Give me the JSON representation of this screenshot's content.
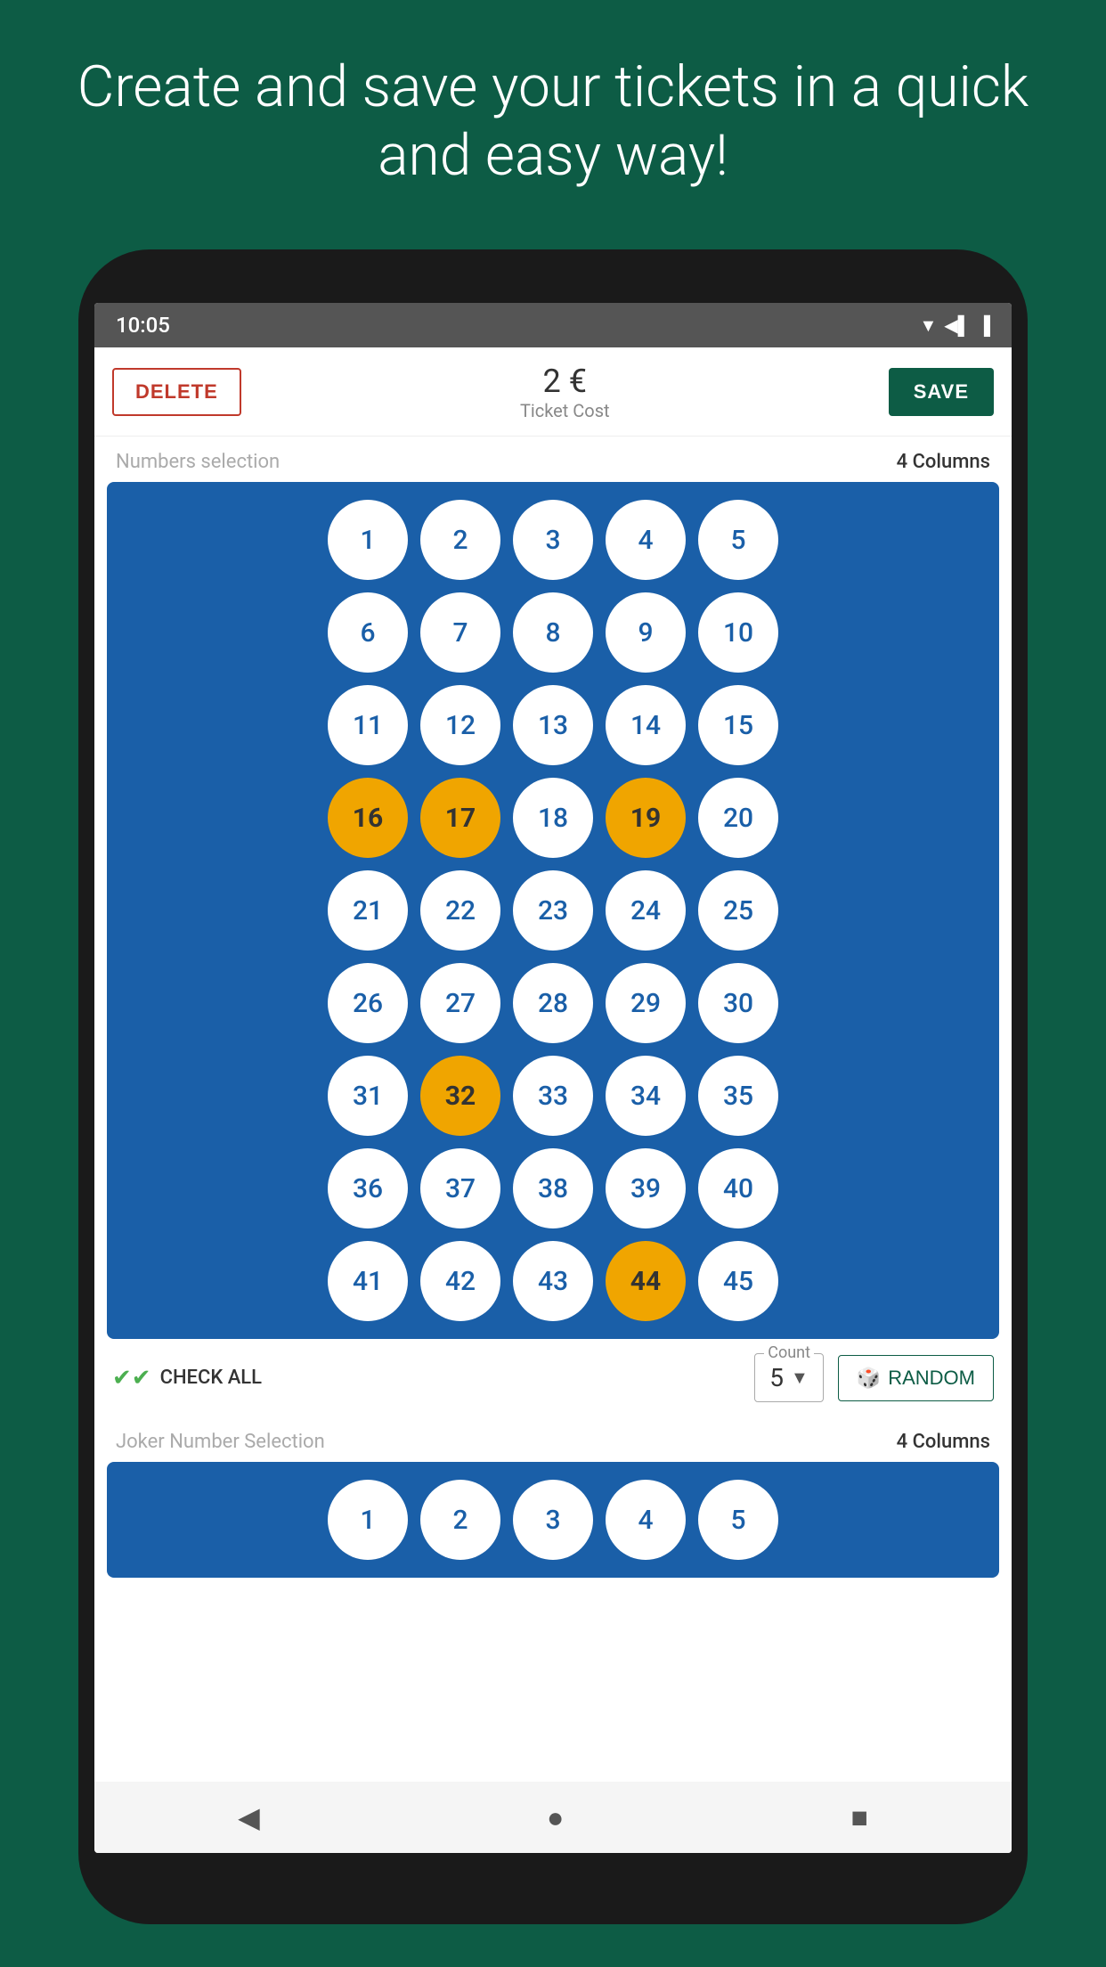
{
  "hero": {
    "text": "Create and save your tickets in a quick and easy way!"
  },
  "status_bar": {
    "time": "10:05",
    "icons": "▼◀ ▌▌▌"
  },
  "top_bar": {
    "delete_label": "DELETE",
    "ticket_amount": "2 €",
    "ticket_cost_label": "Ticket Cost",
    "save_label": "SAVE"
  },
  "numbers_section": {
    "label": "Numbers selection",
    "columns_label": "4 Columns"
  },
  "numbers": [
    {
      "value": 1,
      "selected": false
    },
    {
      "value": 2,
      "selected": false
    },
    {
      "value": 3,
      "selected": false
    },
    {
      "value": 4,
      "selected": false
    },
    {
      "value": 5,
      "selected": false
    },
    {
      "value": 6,
      "selected": false
    },
    {
      "value": 7,
      "selected": false
    },
    {
      "value": 8,
      "selected": false
    },
    {
      "value": 9,
      "selected": false
    },
    {
      "value": 10,
      "selected": false
    },
    {
      "value": 11,
      "selected": false
    },
    {
      "value": 12,
      "selected": false
    },
    {
      "value": 13,
      "selected": false
    },
    {
      "value": 14,
      "selected": false
    },
    {
      "value": 15,
      "selected": false
    },
    {
      "value": 16,
      "selected": true
    },
    {
      "value": 17,
      "selected": true
    },
    {
      "value": 18,
      "selected": false
    },
    {
      "value": 19,
      "selected": true
    },
    {
      "value": 20,
      "selected": false
    },
    {
      "value": 21,
      "selected": false
    },
    {
      "value": 22,
      "selected": false
    },
    {
      "value": 23,
      "selected": false
    },
    {
      "value": 24,
      "selected": false
    },
    {
      "value": 25,
      "selected": false
    },
    {
      "value": 26,
      "selected": false
    },
    {
      "value": 27,
      "selected": false
    },
    {
      "value": 28,
      "selected": false
    },
    {
      "value": 29,
      "selected": false
    },
    {
      "value": 30,
      "selected": false
    },
    {
      "value": 31,
      "selected": false
    },
    {
      "value": 32,
      "selected": true
    },
    {
      "value": 33,
      "selected": false
    },
    {
      "value": 34,
      "selected": false
    },
    {
      "value": 35,
      "selected": false
    },
    {
      "value": 36,
      "selected": false
    },
    {
      "value": 37,
      "selected": false
    },
    {
      "value": 38,
      "selected": false
    },
    {
      "value": 39,
      "selected": false
    },
    {
      "value": 40,
      "selected": false
    },
    {
      "value": 41,
      "selected": false
    },
    {
      "value": 42,
      "selected": false
    },
    {
      "value": 43,
      "selected": false
    },
    {
      "value": 44,
      "selected": true
    },
    {
      "value": 45,
      "selected": false
    }
  ],
  "bottom_controls": {
    "check_all_label": "CHECK ALL",
    "count_label": "Count",
    "count_value": "5",
    "random_label": "RANDOM"
  },
  "joker_section": {
    "label": "Joker Number Selection",
    "columns_label": "4 Columns"
  },
  "joker_numbers": [
    {
      "value": 1,
      "selected": false
    },
    {
      "value": 2,
      "selected": false
    },
    {
      "value": 3,
      "selected": false
    },
    {
      "value": 4,
      "selected": false
    },
    {
      "value": 5,
      "selected": false
    }
  ],
  "nav": {
    "back_icon": "◀",
    "home_icon": "●",
    "recent_icon": "■"
  }
}
